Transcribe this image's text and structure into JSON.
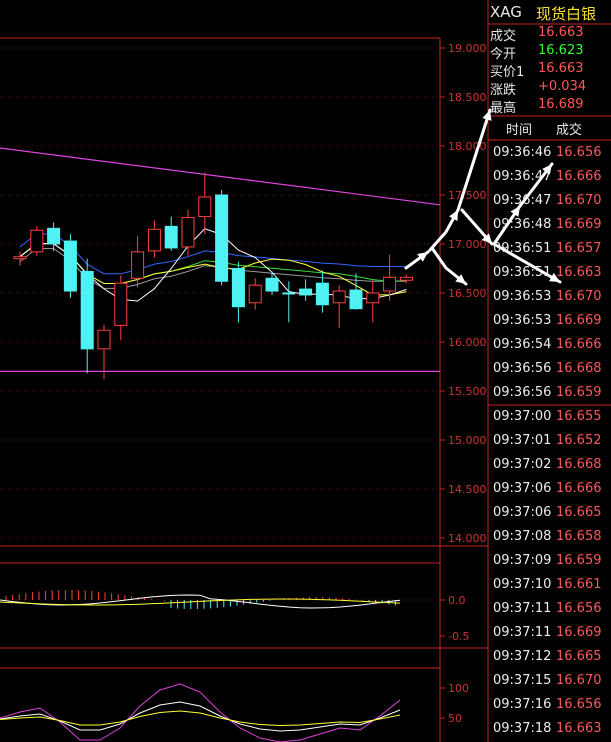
{
  "header": {
    "symbol": "XAG",
    "name": "现货白银"
  },
  "quote": [
    {
      "label": "成交",
      "value": "16.663",
      "color": "#ff5757"
    },
    {
      "label": "今开",
      "value": "16.623",
      "color": "#33ff33"
    },
    {
      "label": "买价1",
      "value": "16.663",
      "color": "#ff5757"
    },
    {
      "label": "涨跌",
      "value": "+0.034",
      "color": "#ff5757"
    },
    {
      "label": "最高",
      "value": "16.689",
      "color": "#ff5757"
    }
  ],
  "ticks_header": {
    "time": "时间",
    "price": "成交"
  },
  "ticks": [
    {
      "time": "09:36:46",
      "price": "16.656"
    },
    {
      "time": "09:36:47",
      "price": "16.666"
    },
    {
      "time": "09:36:47",
      "price": "16.670"
    },
    {
      "time": "09:36:48",
      "price": "16.669"
    },
    {
      "time": "09:36:51",
      "price": "16.657"
    },
    {
      "time": "09:36:51",
      "price": "16.663"
    },
    {
      "time": "09:36:53",
      "price": "16.670"
    },
    {
      "time": "09:36:53",
      "price": "16.669"
    },
    {
      "time": "09:36:54",
      "price": "16.666"
    },
    {
      "time": "09:36:56",
      "price": "16.668"
    },
    {
      "time": "09:36:56",
      "price": "16.659"
    },
    {
      "time": "09:37:00",
      "price": "16.655"
    },
    {
      "time": "09:37:01",
      "price": "16.652"
    },
    {
      "time": "09:37:02",
      "price": "16.668"
    },
    {
      "time": "09:37:06",
      "price": "16.666"
    },
    {
      "time": "09:37:06",
      "price": "16.665"
    },
    {
      "time": "09:37:08",
      "price": "16.658"
    },
    {
      "time": "09:37:09",
      "price": "16.659"
    },
    {
      "time": "09:37:10",
      "price": "16.661"
    },
    {
      "time": "09:37:11",
      "price": "16.656"
    },
    {
      "time": "09:37:11",
      "price": "16.669"
    },
    {
      "time": "09:37:12",
      "price": "16.665"
    },
    {
      "time": "09:37:15",
      "price": "16.670"
    },
    {
      "time": "09:37:16",
      "price": "16.656"
    },
    {
      "time": "09:37:18",
      "price": "16.663"
    }
  ],
  "colors": {
    "up": "#ff4040",
    "down": "#4ef2f2",
    "axis": "#cc2222",
    "axis_text": "#cc3333",
    "trend": "#dd44dd",
    "ma5": "#ffffff",
    "ma10": "#ffff33",
    "ma20": "#33dd33",
    "ma60": "#3366ff",
    "ma_gray": "#999999"
  },
  "chart_data": [
    {
      "type": "candlestick",
      "panel": "price",
      "yticks": [
        "19.000",
        "18.500",
        "18.000",
        "17.500",
        "17.000",
        "16.500",
        "16.000",
        "15.500",
        "15.000",
        "14.500",
        "14.000"
      ],
      "ylim": [
        14.0,
        19.0
      ],
      "candles": [
        {
          "o": 16.85,
          "h": 16.92,
          "l": 16.78,
          "c": 16.87
        },
        {
          "o": 16.92,
          "h": 17.18,
          "l": 16.88,
          "c": 17.14
        },
        {
          "o": 17.16,
          "h": 17.22,
          "l": 16.93,
          "c": 17.0
        },
        {
          "o": 17.03,
          "h": 17.1,
          "l": 16.45,
          "c": 16.52
        },
        {
          "o": 16.72,
          "h": 16.85,
          "l": 15.68,
          "c": 15.93
        },
        {
          "o": 15.93,
          "h": 16.18,
          "l": 15.62,
          "c": 16.12
        },
        {
          "o": 16.17,
          "h": 16.68,
          "l": 16.02,
          "c": 16.6
        },
        {
          "o": 16.65,
          "h": 17.08,
          "l": 16.56,
          "c": 16.92
        },
        {
          "o": 16.93,
          "h": 17.24,
          "l": 16.86,
          "c": 17.15
        },
        {
          "o": 17.18,
          "h": 17.28,
          "l": 16.93,
          "c": 16.96
        },
        {
          "o": 16.97,
          "h": 17.35,
          "l": 16.88,
          "c": 17.27
        },
        {
          "o": 17.28,
          "h": 17.73,
          "l": 17.1,
          "c": 17.48
        },
        {
          "o": 17.5,
          "h": 17.55,
          "l": 16.58,
          "c": 16.62
        },
        {
          "o": 16.75,
          "h": 16.82,
          "l": 16.2,
          "c": 16.36
        },
        {
          "o": 16.4,
          "h": 16.65,
          "l": 16.33,
          "c": 16.58
        },
        {
          "o": 16.65,
          "h": 16.72,
          "l": 16.48,
          "c": 16.52
        },
        {
          "o": 16.5,
          "h": 16.62,
          "l": 16.2,
          "c": 16.49
        },
        {
          "o": 16.54,
          "h": 16.64,
          "l": 16.42,
          "c": 16.48
        },
        {
          "o": 16.6,
          "h": 16.73,
          "l": 16.3,
          "c": 16.38
        },
        {
          "o": 16.4,
          "h": 16.58,
          "l": 16.14,
          "c": 16.52
        },
        {
          "o": 16.53,
          "h": 16.7,
          "l": 16.33,
          "c": 16.34
        },
        {
          "o": 16.4,
          "h": 16.62,
          "l": 16.2,
          "c": 16.5
        },
        {
          "o": 16.52,
          "h": 16.89,
          "l": 16.42,
          "c": 16.66
        },
        {
          "o": 16.63,
          "h": 16.69,
          "l": 16.6,
          "c": 16.66
        }
      ],
      "trendlines": [
        {
          "x": [
            0,
            1
          ],
          "y": [
            17.98,
            17.4
          ]
        },
        {
          "x": [
            0,
            1
          ],
          "y": [
            15.7,
            15.7
          ]
        }
      ]
    },
    {
      "type": "line",
      "panel": "macd",
      "yticks": [
        "0.0",
        "-0.5"
      ]
    },
    {
      "type": "line",
      "panel": "kdj",
      "yticks": [
        "100",
        "50"
      ]
    }
  ]
}
